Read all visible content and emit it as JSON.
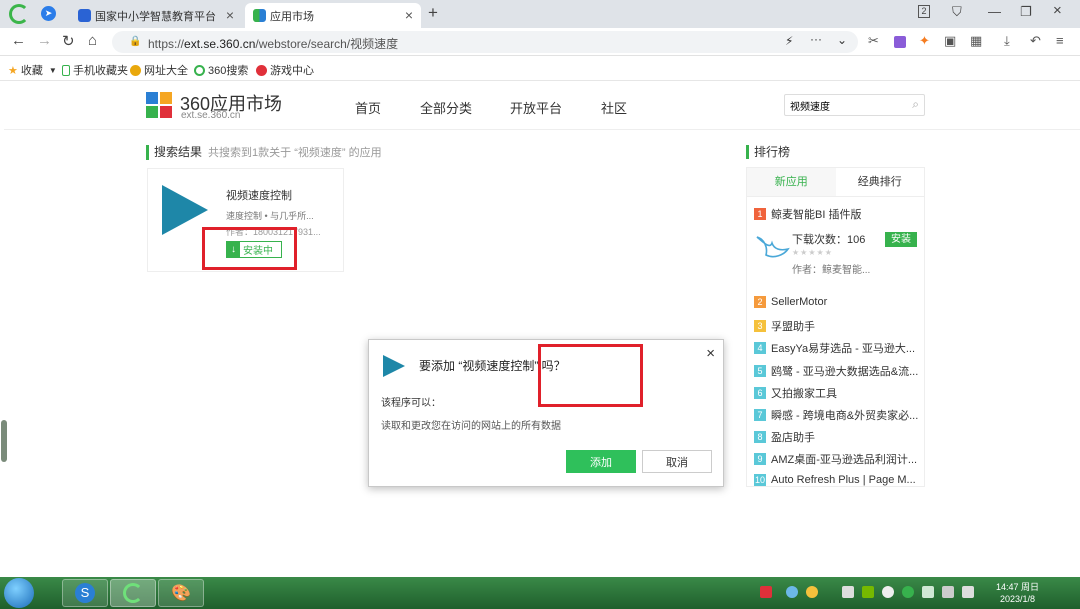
{
  "browser": {
    "tabs": [
      {
        "title": "国家中小学智慧教育平台"
      },
      {
        "title": "应用市场"
      }
    ],
    "tab_count_badge": "2",
    "url_scheme": "https://",
    "url_domain": "ext.se.360.cn",
    "url_path": "/webstore/search/视频速度",
    "bookmarks": [
      "收藏",
      "手机收藏夹",
      "网址大全",
      "360搜索",
      "游戏中心"
    ]
  },
  "site": {
    "logo_title": "360应用市场",
    "logo_sub": "ext.se.360.cn",
    "nav": [
      "首页",
      "全部分类",
      "开放平台",
      "社区"
    ],
    "search_value": "视频速度"
  },
  "results": {
    "heading": "搜索结果",
    "summary": "共搜索到1款关于 “视频速度” 的应用",
    "card": {
      "title": "视频速度控制",
      "desc": "速度控制 • 与几乎所...",
      "author": "作者：180031217931...",
      "status": "安装中"
    }
  },
  "ranking": {
    "heading": "排行榜",
    "tabs": [
      "新应用",
      "经典排行"
    ],
    "featured": {
      "name": "鲸麦智能BI 插件版",
      "downloads": "下载次数：106",
      "author": "作者：鲸麦智能...",
      "install": "安装"
    },
    "items": [
      {
        "rank": "2",
        "name": "SellerMotor",
        "color": "#f59a3c"
      },
      {
        "rank": "3",
        "name": "孚盟助手",
        "color": "#f5c13c"
      },
      {
        "rank": "4",
        "name": "EasyYa易芽选品 - 亚马逊大...",
        "color": "#5ac8d8"
      },
      {
        "rank": "5",
        "name": "鸥鹭 - 亚马逊大数据选品&流...",
        "color": "#5ac8d8"
      },
      {
        "rank": "6",
        "name": "又拍搬家工具",
        "color": "#5ac8d8"
      },
      {
        "rank": "7",
        "name": "瞬感 - 跨境电商&外贸卖家必...",
        "color": "#5ac8d8"
      },
      {
        "rank": "8",
        "name": "盈店助手",
        "color": "#5ac8d8"
      },
      {
        "rank": "9",
        "name": "AMZ桌面-亚马逊选品利润计...",
        "color": "#5ac8d8"
      },
      {
        "rank": "10",
        "name": "Auto Refresh Plus | Page M...",
        "color": "#5ac8d8"
      }
    ],
    "top_rank": "1",
    "top_color": "#f0633c"
  },
  "dialog": {
    "title": "要添加 “视频速度控制” 吗？",
    "perm_heading": "该程序可以：",
    "perm_item": "读取和更改您在访问的网站上的所有数据",
    "add": "添加",
    "cancel": "取消"
  },
  "taskbar": {
    "time": "14:47 周日",
    "date": "2023/1/8"
  }
}
